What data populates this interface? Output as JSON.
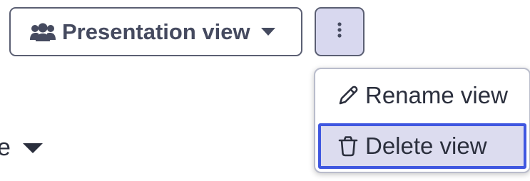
{
  "toolbar": {
    "view_selector": {
      "label": "Presentation view",
      "icon": "users-icon"
    },
    "more_options": {
      "icon": "kebab-vertical-icon"
    }
  },
  "background_fragment": {
    "text": "e",
    "icon": "caret-down-icon"
  },
  "menu": {
    "items": [
      {
        "label": "Rename view",
        "icon": "pencil-icon"
      },
      {
        "label": "Delete view",
        "icon": "trash-icon",
        "focused": true
      }
    ]
  },
  "colors": {
    "button_text": "#454a5f",
    "button_border": "#5b5f73",
    "kebab_background": "#d8d8ef",
    "menu_focus_background": "#dcdcef",
    "focus_ring": "#3f57e0"
  }
}
